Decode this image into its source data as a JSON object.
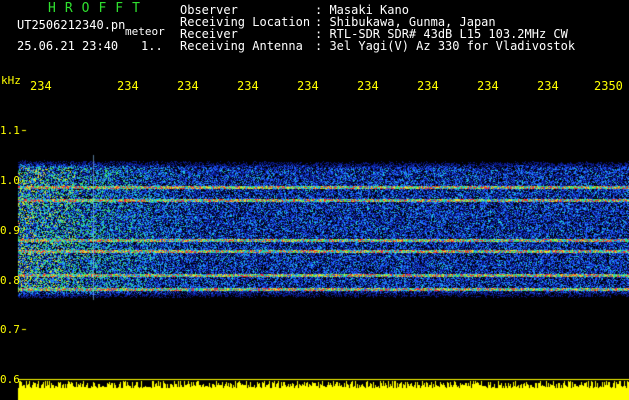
{
  "header": {
    "brand": "HROFFT",
    "filename": "UT2506212340.pn",
    "meteor_tag": "meteor",
    "timestamp": "25.06.21 23:40",
    "count": "1.."
  },
  "info": [
    {
      "label": "Observer",
      "value": ": Masaki Kano"
    },
    {
      "label": "Receiving Location",
      "value": ": Shibukawa, Gunma, Japan"
    },
    {
      "label": "Receiver",
      "value": ": RTL-SDR SDR# 43dB L15 103.2MHz CW"
    },
    {
      "label": "Receiving Antenna",
      "value": ": 3el Yagi(V) Az 330 for Vladivostok"
    }
  ],
  "axis": {
    "unit": "kHz",
    "x_ticks": [
      "234",
      "234",
      "234",
      "234",
      "234",
      "234",
      "234",
      "234",
      "234",
      "2350"
    ],
    "y_ticks": [
      "1.1",
      "1.0",
      "0.9",
      "0.8",
      "0.7",
      "0.6"
    ]
  },
  "colors": {
    "background": "#000000",
    "header_green": "#2fe02f",
    "tick_yellow": "#ffff00",
    "text_white": "#ffffff"
  }
}
